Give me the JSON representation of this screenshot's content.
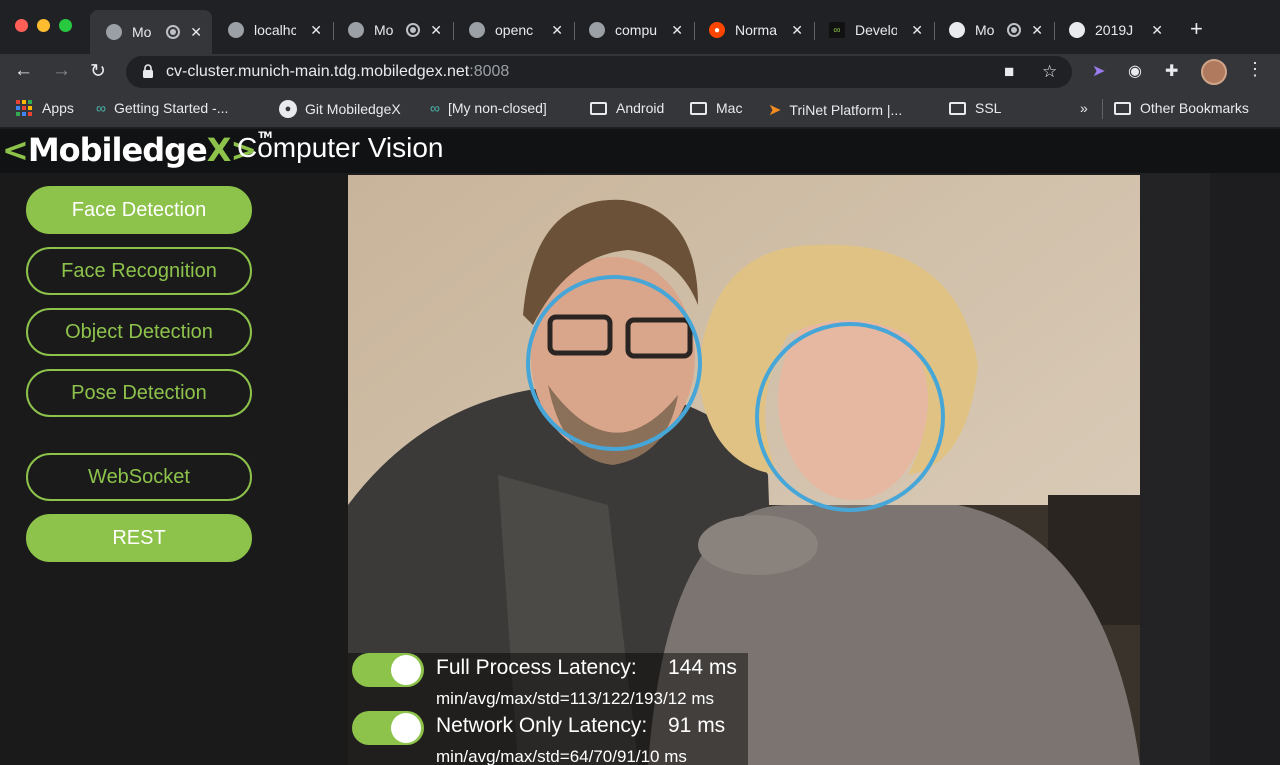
{
  "browser": {
    "tabs": [
      {
        "title": "Mo",
        "favicon": "globe-icon",
        "active": true,
        "recording": true
      },
      {
        "title": "localhc",
        "favicon": "globe-icon"
      },
      {
        "title": "Mo",
        "favicon": "globe-icon",
        "recording": true
      },
      {
        "title": "openc",
        "favicon": "globe-icon"
      },
      {
        "title": "compu",
        "favicon": "globe-icon"
      },
      {
        "title": "Norma",
        "favicon": "reddit-icon"
      },
      {
        "title": "Develo",
        "favicon": "mobiledgex-icon"
      },
      {
        "title": "Mo",
        "favicon": "globe-icon",
        "recording": true
      },
      {
        "title": "2019J",
        "favicon": "globe-icon"
      }
    ],
    "url_host": "cv-cluster.munich-main.tdg.mobiledgex.net",
    "url_port": ":8008",
    "bookmarks": [
      {
        "label": "Apps",
        "icon": "apps-grid-icon"
      },
      {
        "label": "Getting Started -...",
        "icon": "mobiledgex-icon"
      },
      {
        "label": "Git MobiledgeX",
        "icon": "github-icon"
      },
      {
        "label": "[My non-closed]",
        "icon": "mobiledgex-icon"
      },
      {
        "label": "Android",
        "icon": "folder-icon"
      },
      {
        "label": "Mac",
        "icon": "folder-icon"
      },
      {
        "label": "TriNet Platform |...",
        "icon": "trinet-icon"
      },
      {
        "label": "SSL",
        "icon": "folder-icon"
      }
    ],
    "overflow": "»",
    "other_bookmarks": "Other Bookmarks"
  },
  "app": {
    "logo_prefix": "<",
    "logo_text": "Mobiledge",
    "logo_x": "X",
    "logo_suffix": ">",
    "logo_tm": "TM",
    "title": "Computer Vision",
    "mode_buttons": [
      {
        "label": "Face Detection",
        "selected": true
      },
      {
        "label": "Face Recognition",
        "selected": false
      },
      {
        "label": "Object Detection",
        "selected": false
      },
      {
        "label": "Pose Detection",
        "selected": false
      }
    ],
    "transport_buttons": [
      {
        "label": "WebSocket",
        "selected": false
      },
      {
        "label": "REST",
        "selected": true
      }
    ],
    "accent_color": "#8dc24b",
    "face_ring_color": "#46a6d8"
  },
  "latency": {
    "full_process": {
      "label": "Full Process Latency:",
      "value": "144 ms",
      "stats": "min/avg/max/std=113/122/193/12 ms",
      "enabled": true
    },
    "network_only": {
      "label": "Network Only Latency:",
      "value": "91 ms",
      "stats": "min/avg/max/std=64/70/91/10 ms",
      "enabled": true
    }
  }
}
